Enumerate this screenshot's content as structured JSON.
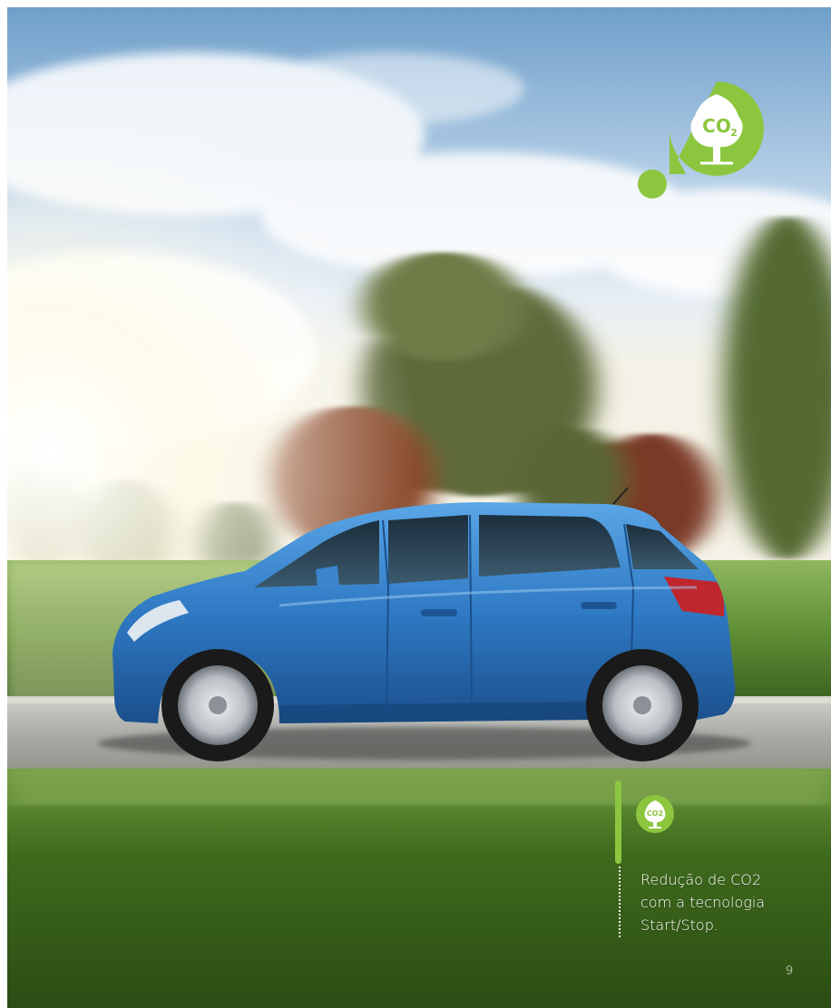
{
  "hero": {
    "image": "car-driving-countryside-photo",
    "co2_icon": "co2-tree-icon",
    "accent_color": "#8cc63f"
  },
  "feature": {
    "icon": "co2-tree-icon",
    "lines": [
      "Redução de CO2",
      "com a tecnologia",
      "Start/Stop."
    ]
  },
  "page_number": "9"
}
